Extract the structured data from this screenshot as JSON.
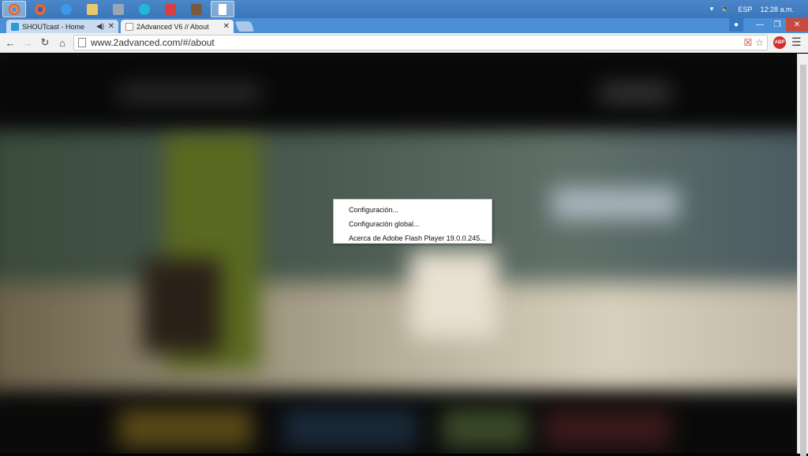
{
  "taskbar": {
    "apps": [
      {
        "icon": "chrome-icon",
        "color": "#e8b23a",
        "active": true
      },
      {
        "icon": "firefox-icon",
        "color": "#e8662a",
        "active": false
      },
      {
        "icon": "internet-explorer-icon",
        "color": "#3a9ae8",
        "active": false
      },
      {
        "icon": "file-explorer-icon",
        "color": "#e8c86a",
        "active": false
      },
      {
        "icon": "calendar-icon",
        "color": "#9aa6b6",
        "active": false
      },
      {
        "icon": "app-icon",
        "color": "#20b8d8",
        "active": false
      },
      {
        "icon": "app-icon",
        "color": "#d84040",
        "active": false
      },
      {
        "icon": "media-icon",
        "color": "#7a5a3a",
        "active": false
      },
      {
        "icon": "document-icon",
        "color": "#ffffff",
        "active": true
      }
    ],
    "tray": {
      "language": "ESP",
      "clock": "12:28 a.m."
    }
  },
  "tabs": [
    {
      "title": "SHOUTcast - Home",
      "active": false,
      "favicon_color": "#2a9ad8"
    },
    {
      "title": "2Advanced V6 // About",
      "active": true,
      "favicon_color": "#cccccc"
    }
  ],
  "toolbar": {
    "url": "www.2advanced.com/#/about",
    "abp_label": "ABP"
  },
  "context_menu": {
    "items": [
      "Configuración...",
      "Configuración global...",
      "Acerca de Adobe Flash Player 19.0.0.245..."
    ]
  }
}
